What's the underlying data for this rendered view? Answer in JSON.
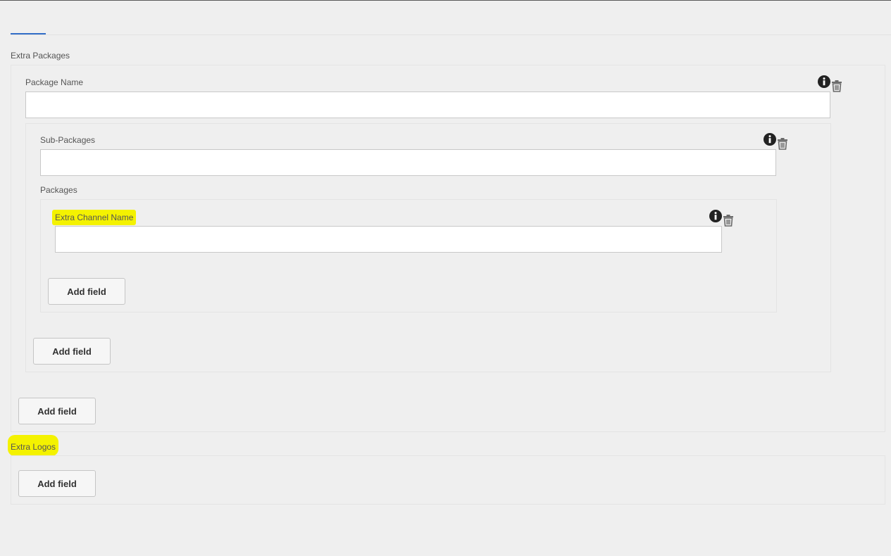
{
  "sections": {
    "extra_packages": {
      "label": "Extra Packages",
      "package_name_label": "Package Name",
      "package_name_value": "",
      "sub_packages_label": "Sub-Packages",
      "sub_packages_value": "",
      "packages_label": "Packages",
      "extra_channel_name_label": "Extra Channel Name",
      "extra_channel_name_value": "",
      "add_field_inner": "Add field",
      "add_field_sub": "Add field",
      "add_field_outer": "Add field"
    },
    "extra_logos": {
      "label": "Extra Logos",
      "add_field": "Add field"
    }
  },
  "icons": {
    "info": "info-icon",
    "delete": "trash-icon"
  },
  "colors": {
    "accent": "#326ec8",
    "highlight": "#f4f200",
    "background": "#efefef"
  }
}
